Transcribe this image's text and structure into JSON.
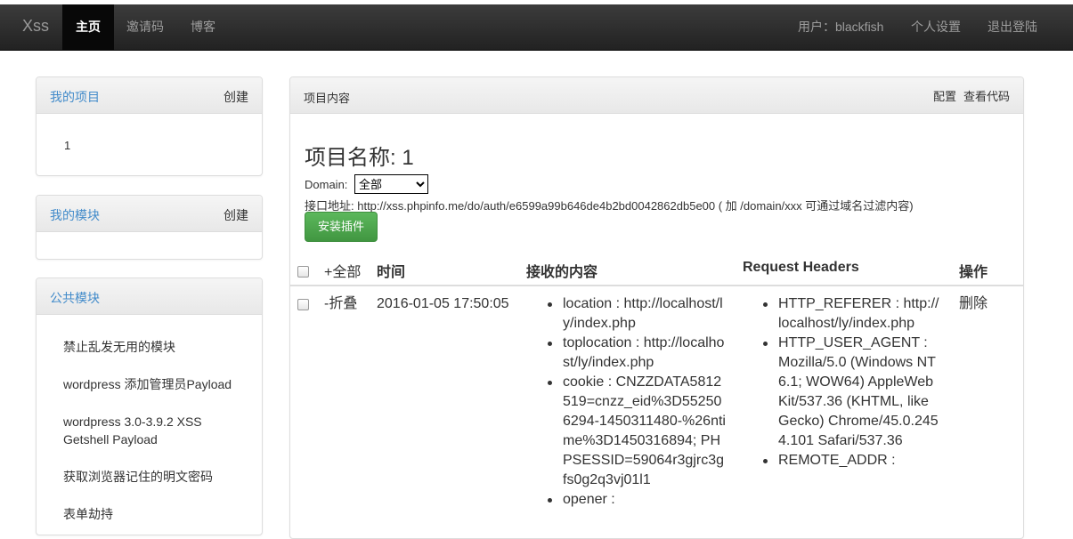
{
  "navbar": {
    "brand": "Xss",
    "nav": [
      "主页",
      "邀请码",
      "博客"
    ],
    "user": "用户：blackfish",
    "settings": "个人设置",
    "logout": "退出登陆"
  },
  "sidebar": {
    "projects": {
      "title": "我的项目",
      "action": "创建",
      "items": [
        "1"
      ]
    },
    "modules": {
      "title": "我的模块",
      "action": "创建"
    },
    "public_modules": {
      "title": "公共模块",
      "items": [
        "禁止乱发无用的模块",
        "wordpress 添加管理员Payload",
        "wordpress 3.0-3.9.2 XSS",
        "Getshell Payload",
        "获取浏览器记住的明文密码",
        "表单劫持"
      ]
    }
  },
  "main": {
    "heading": "项目内容",
    "config": "配置",
    "view_code": "查看代码",
    "project_title": "项目名称: 1",
    "domain_label": "Domain:",
    "domain_value": "全部",
    "api_line": "接口地址: http://xss.phpinfo.me/do/auth/e6599a99b646de4b2bd0042862db5e00 ( 加 /domain/xxx 可通过域名过滤内容)",
    "install_button": "安装插件",
    "table": {
      "headers": [
        "+全部",
        "时间",
        "接收的内容",
        "Request Headers",
        "操作"
      ],
      "row": {
        "toggle": "-折叠",
        "time": "2016-01-05 17:50:05",
        "content": [
          "location : http://localhost/ly/index.php",
          "toplocation : http://localhost/ly/index.php",
          "cookie : CNZZDATA5812519=cnzz_eid%3D552506294-1450311480-%26ntime%3D1450316894; PHPSESSID=59064r3gjrc3gfs0g2q3vj01l1",
          "opener :"
        ],
        "headers": [
          "HTTP_REFERER : http://localhost/ly/index.php",
          "HTTP_USER_AGENT : Mozilla/5.0 (Windows NT 6.1; WOW64) AppleWebKit/537.36 (KHTML, like Gecko) Chrome/45.0.2454.101 Safari/537.36",
          "REMOTE_ADDR :"
        ],
        "action": "删除"
      }
    }
  }
}
